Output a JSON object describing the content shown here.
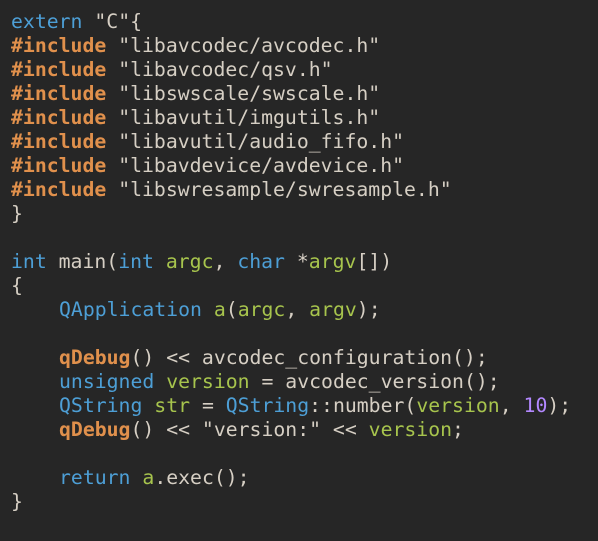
{
  "editor": {
    "background": "#262626",
    "lines": [
      {
        "tokens": [
          {
            "t": "extern",
            "c": "kw"
          },
          {
            "t": " \"C\"{",
            "c": "plain"
          }
        ]
      },
      {
        "tokens": [
          {
            "t": "#include",
            "c": "pp"
          },
          {
            "t": " \"libavcodec/avcodec.h\"",
            "c": "str"
          }
        ]
      },
      {
        "tokens": [
          {
            "t": "#include",
            "c": "pp"
          },
          {
            "t": " \"libavcodec/qsv.h\"",
            "c": "str"
          }
        ]
      },
      {
        "tokens": [
          {
            "t": "#include",
            "c": "pp"
          },
          {
            "t": " \"libswscale/swscale.h\"",
            "c": "str"
          }
        ]
      },
      {
        "tokens": [
          {
            "t": "#include",
            "c": "pp"
          },
          {
            "t": " \"libavutil/imgutils.h\"",
            "c": "str"
          }
        ]
      },
      {
        "tokens": [
          {
            "t": "#include",
            "c": "pp"
          },
          {
            "t": " \"libavutil/audio_fifo.h\"",
            "c": "str"
          }
        ]
      },
      {
        "tokens": [
          {
            "t": "#include",
            "c": "pp"
          },
          {
            "t": " \"libavdevice/avdevice.h\"",
            "c": "str"
          }
        ]
      },
      {
        "tokens": [
          {
            "t": "#include",
            "c": "pp"
          },
          {
            "t": " \"libswresample/swresample.h\"",
            "c": "str"
          }
        ]
      },
      {
        "tokens": [
          {
            "t": "}",
            "c": "plain"
          }
        ]
      },
      {
        "tokens": []
      },
      {
        "tokens": [
          {
            "t": "int",
            "c": "type"
          },
          {
            "t": " main(",
            "c": "plain"
          },
          {
            "t": "int",
            "c": "type"
          },
          {
            "t": " ",
            "c": "plain"
          },
          {
            "t": "argc",
            "c": "param"
          },
          {
            "t": ", ",
            "c": "plain"
          },
          {
            "t": "char",
            "c": "type"
          },
          {
            "t": " *",
            "c": "plain"
          },
          {
            "t": "argv",
            "c": "param"
          },
          {
            "t": "[])",
            "c": "plain"
          }
        ]
      },
      {
        "tokens": [
          {
            "t": "{",
            "c": "plain"
          }
        ]
      },
      {
        "indent": 1,
        "tokens": [
          {
            "t": "QApplication",
            "c": "cls"
          },
          {
            "t": " ",
            "c": "plain"
          },
          {
            "t": "a",
            "c": "var"
          },
          {
            "t": "(",
            "c": "plain"
          },
          {
            "t": "argc",
            "c": "param"
          },
          {
            "t": ", ",
            "c": "plain"
          },
          {
            "t": "argv",
            "c": "param"
          },
          {
            "t": ");",
            "c": "plain"
          }
        ]
      },
      {
        "tokens": []
      },
      {
        "indent": 1,
        "tokens": [
          {
            "t": "qDebug",
            "c": "fn-dbg"
          },
          {
            "t": "() << avcodec_configuration();",
            "c": "plain"
          }
        ]
      },
      {
        "indent": 1,
        "tokens": [
          {
            "t": "unsigned",
            "c": "kw"
          },
          {
            "t": " ",
            "c": "plain"
          },
          {
            "t": "version",
            "c": "var"
          },
          {
            "t": " = avcodec_version();",
            "c": "plain"
          }
        ]
      },
      {
        "indent": 1,
        "tokens": [
          {
            "t": "QString",
            "c": "cls"
          },
          {
            "t": " ",
            "c": "plain"
          },
          {
            "t": "str",
            "c": "var"
          },
          {
            "t": " = ",
            "c": "plain"
          },
          {
            "t": "QString",
            "c": "cls"
          },
          {
            "t": "::number(",
            "c": "plain"
          },
          {
            "t": "version",
            "c": "var"
          },
          {
            "t": ", ",
            "c": "plain"
          },
          {
            "t": "10",
            "c": "num"
          },
          {
            "t": ");",
            "c": "plain"
          }
        ]
      },
      {
        "indent": 1,
        "tokens": [
          {
            "t": "qDebug",
            "c": "fn-dbg"
          },
          {
            "t": "() << \"version:\" << ",
            "c": "plain"
          },
          {
            "t": "version",
            "c": "var"
          },
          {
            "t": ";",
            "c": "plain"
          }
        ]
      },
      {
        "tokens": []
      },
      {
        "indent": 1,
        "tokens": [
          {
            "t": "return",
            "c": "kw"
          },
          {
            "t": " ",
            "c": "plain"
          },
          {
            "t": "a",
            "c": "var"
          },
          {
            "t": ".exec();",
            "c": "plain"
          }
        ]
      },
      {
        "tokens": [
          {
            "t": "}",
            "c": "plain"
          }
        ]
      }
    ]
  }
}
